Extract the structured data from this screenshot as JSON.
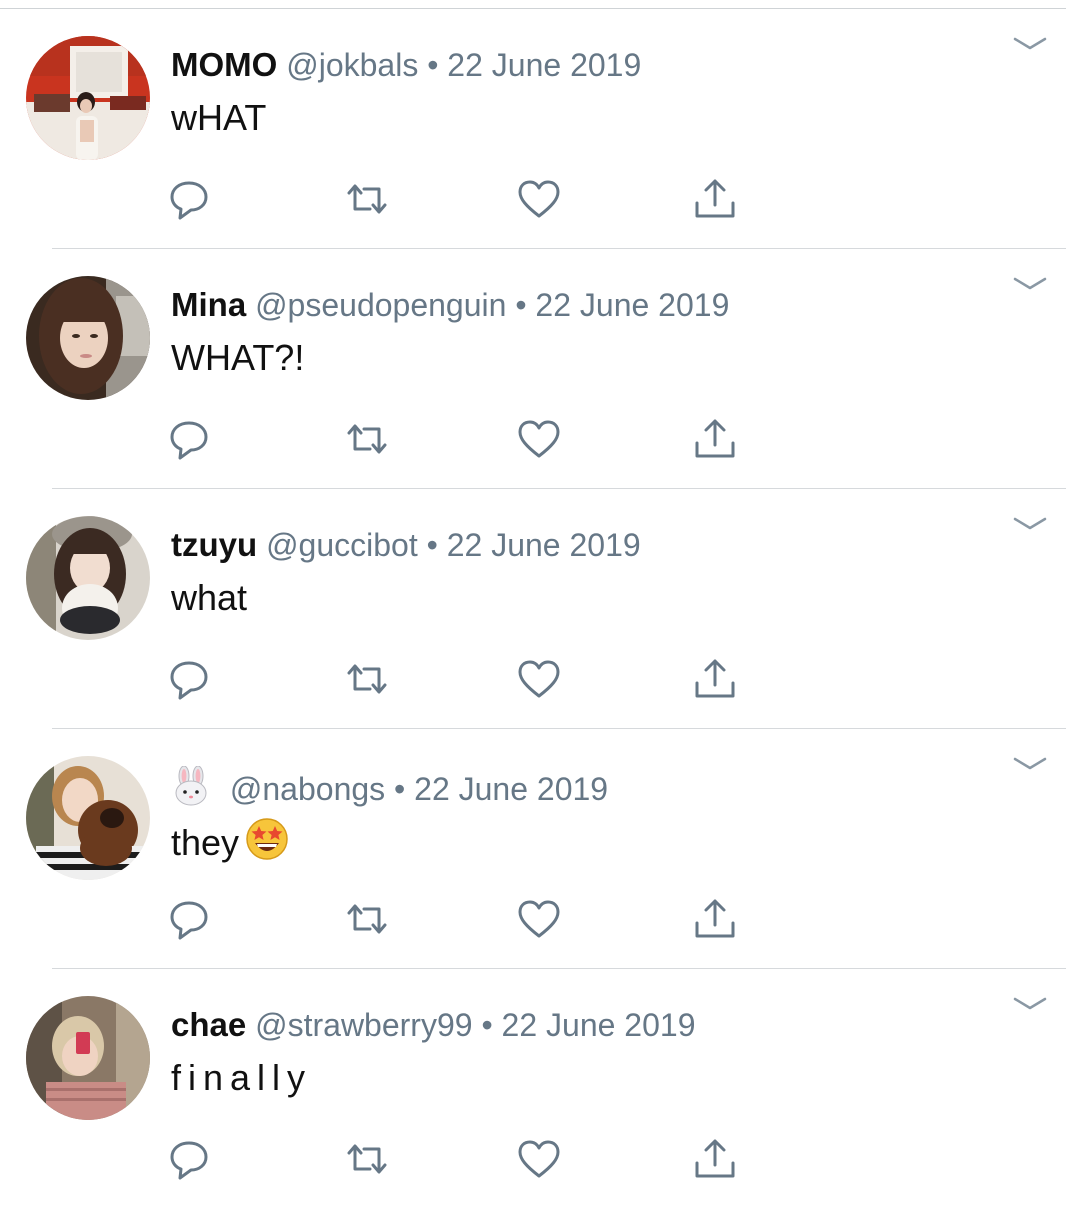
{
  "timeline": {
    "tweets": [
      {
        "display_name": "MOMO",
        "handle": "@jokbals",
        "separator": "•",
        "date": "22 June 2019",
        "text": "wHAT"
      },
      {
        "display_name": "Mina",
        "handle": "@pseudopenguin",
        "separator": "•",
        "date": "22 June 2019",
        "text": "WHAT?!"
      },
      {
        "display_name": "tzuyu",
        "handle": "@guccibot",
        "separator": "•",
        "date": "22 June 2019",
        "text": "what"
      },
      {
        "display_name": "",
        "display_name_icon": "rabbit-face-emoji",
        "handle": "@nabongs",
        "separator": "•",
        "date": "22 June 2019",
        "text": "they",
        "text_emoji": "star-struck-emoji"
      },
      {
        "display_name": "chae",
        "handle": "@strawberry99",
        "separator": "•",
        "date": "22 June 2019",
        "text": "finally"
      }
    ],
    "action_icons": [
      "reply-icon",
      "retweet-icon",
      "like-icon",
      "share-icon"
    ],
    "menu_icon": "chevron-down-icon"
  },
  "colors": {
    "text_primary": "#111111",
    "text_secondary": "#667786",
    "icon": "#667786",
    "divider": "#d6d9dc",
    "background": "#ffffff"
  }
}
